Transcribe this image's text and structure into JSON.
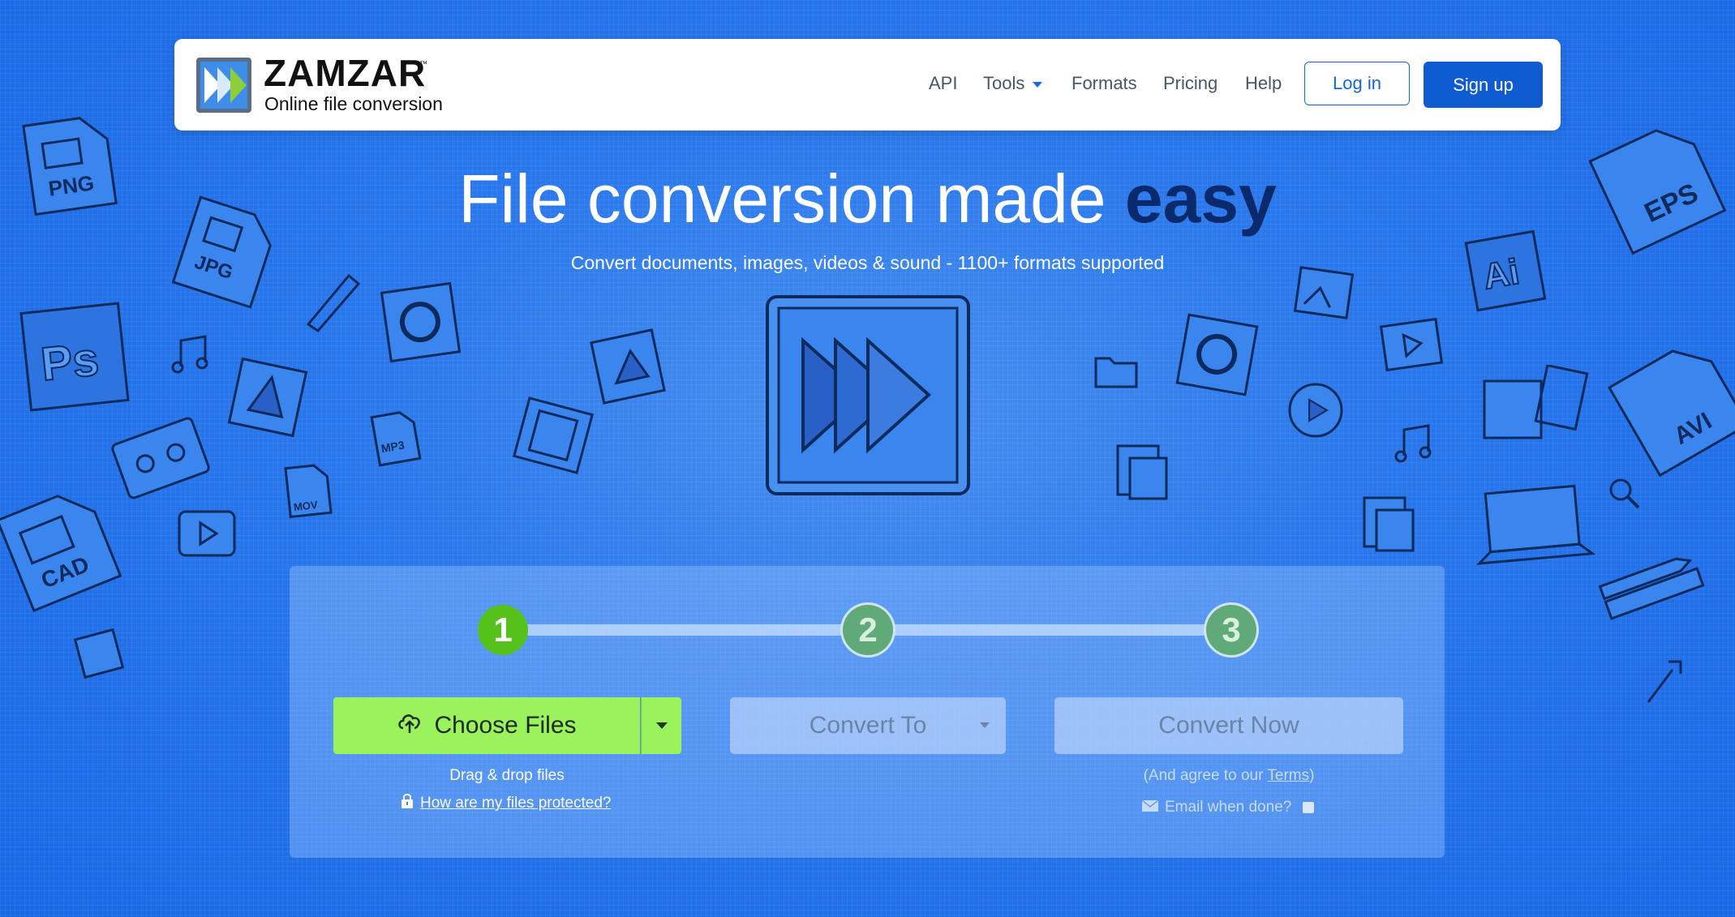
{
  "brand": {
    "name": "ZAMZAR",
    "tm": "™",
    "tagline": "Online file conversion"
  },
  "nav": {
    "links": [
      {
        "label": "API"
      },
      {
        "label": "Tools"
      },
      {
        "label": "Formats"
      },
      {
        "label": "Pricing"
      },
      {
        "label": "Help"
      }
    ],
    "login_label": "Log in",
    "signup_label": "Sign up"
  },
  "hero": {
    "title_main": "File conversion made",
    "title_emphasis": "easy",
    "subtitle": "Convert documents, images, videos & sound - 1100+ formats supported"
  },
  "decor_labels": {
    "png": "PNG",
    "jpg": "JPG",
    "ps": "Ps",
    "cad": "CAD",
    "mp3": "MP3",
    "mov": "MOV",
    "eps": "EPS",
    "ai": "Ai",
    "avi": "AVI"
  },
  "converter": {
    "steps": [
      "1",
      "2",
      "3"
    ],
    "choose_files_label": "Choose Files",
    "drag_drop_text": "Drag & drop files",
    "protection_link": "How are my files protected?",
    "convert_to_label": "Convert To",
    "convert_now_label": "Convert Now",
    "agree_prefix": "(And agree to our ",
    "agree_link": "Terms",
    "agree_suffix": ")",
    "email_label": "Email when done?"
  },
  "colors": {
    "background": "#2a78ec",
    "brand_blue": "#0f5bd0",
    "step_active": "#55c21c",
    "choose_button": "#9af25c",
    "title_emphasis": "#0b2a6b"
  },
  "icons": [
    "upload-cloud-icon",
    "lock-icon",
    "envelope-icon",
    "caret-down-icon",
    "zamzar-logo-icon"
  ]
}
